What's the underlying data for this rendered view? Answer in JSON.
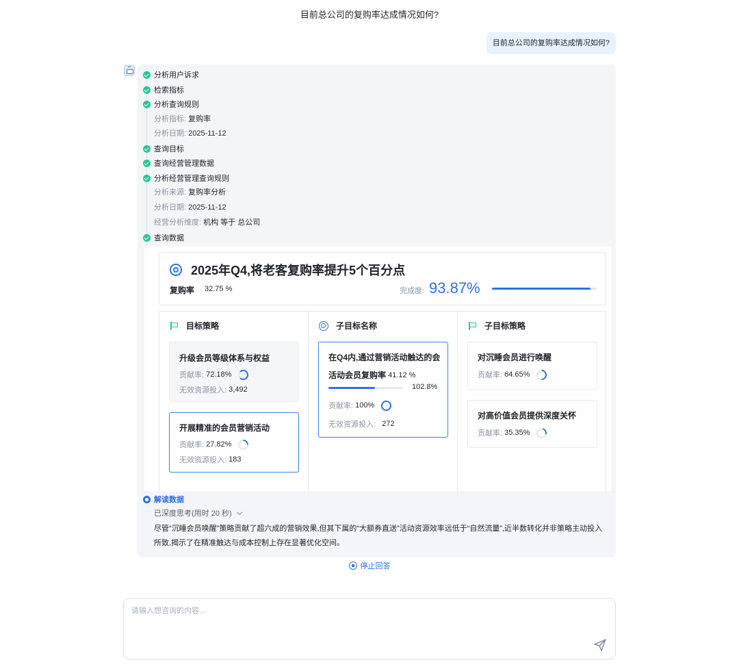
{
  "header": {
    "title": "目前总公司的复购率达成情况如何?"
  },
  "user_message": "目前总公司的复购率达成情况如何?",
  "steps": [
    {
      "label": "分析用户诉求"
    },
    {
      "label": "检索指标"
    },
    {
      "label": "分析查询规则"
    },
    {
      "label": "查询目标"
    },
    {
      "label": "查询经营管理数据"
    },
    {
      "label": "分析经营管理查询规则"
    },
    {
      "label": "查询数据"
    },
    {
      "label": "解读数据"
    }
  ],
  "rule_details": {
    "metric_key": "分析指标:",
    "metric_value": "复购率",
    "date_key": "分析日期:",
    "date_value": "2025-11-12"
  },
  "mgmt_details": {
    "source_key": "分析来源:",
    "source_value": "复购率分析",
    "date_key": "分析日期:",
    "date_value": "2025-11-12",
    "dimension_key": "经营分析维度:",
    "dimension_value": "机构 等于 总公司"
  },
  "goal": {
    "title": "2025年Q4,将老客复购率提升5个百分点",
    "metric_label": "复购率",
    "metric_value": "32.75 %",
    "completion_label": "完成度:",
    "completion_value": "93.87%",
    "completion_fraction": 0.9387
  },
  "columns": {
    "strategy_header": "目标策略",
    "subgoal_header": "子目标名称",
    "sub_strategy_header": "子目标策略"
  },
  "strategy_cards": [
    {
      "title": "升级会员等级体系与权益",
      "contrib_key": "贡献率:",
      "contrib_value": "72.18%",
      "invest_key": "无效资源投入:",
      "invest_value": "3,492"
    },
    {
      "title": "开展精准的会员营销活动",
      "contrib_key": "贡献率:",
      "contrib_value": "27.82%",
      "invest_key": "无效资源投入:",
      "invest_value": "183"
    }
  ],
  "subgoal_card": {
    "title_line1": "在Q4内,通过营销活动触达的会",
    "title_line2": "活动会员复购率",
    "rate": "41.12 %",
    "progress_value": "102.8%",
    "contrib_key": "贡献率:",
    "contrib_value": "100%",
    "invest_key": "无效资源投入:",
    "invest_value": "272"
  },
  "sub_strategy_cards": [
    {
      "title": "对沉睡会员进行唤醒",
      "contrib_key": "贡献率:",
      "contrib_value": "64.65%"
    },
    {
      "title": "对高价值会员提供深度关怀",
      "contrib_key": "贡献率:",
      "contrib_value": "35.35%"
    }
  ],
  "thinking": {
    "label": "已深度思考(用时 20 秒)"
  },
  "summary": "尽管“沉睡会员唤醒”策略贡献了超六成的营销效果,但其下属的“大额券直送”活动资源效率远低于“自然流量”,近半数转化并非策略主动投入所致,揭示了在精准触达与成本控制上存在显著优化空间。",
  "stop_button": {
    "label": "停止回答"
  },
  "composer": {
    "placeholder": "请输入想咨询的内容..."
  },
  "colors": {
    "accent": "#2f6fe4",
    "success": "#24c79a",
    "panel": "#f4f5f7"
  },
  "icons": {
    "check": "check-circle-icon",
    "target": "target-icon",
    "flag": "flag-icon",
    "send": "send-icon",
    "stop": "stop-icon"
  }
}
